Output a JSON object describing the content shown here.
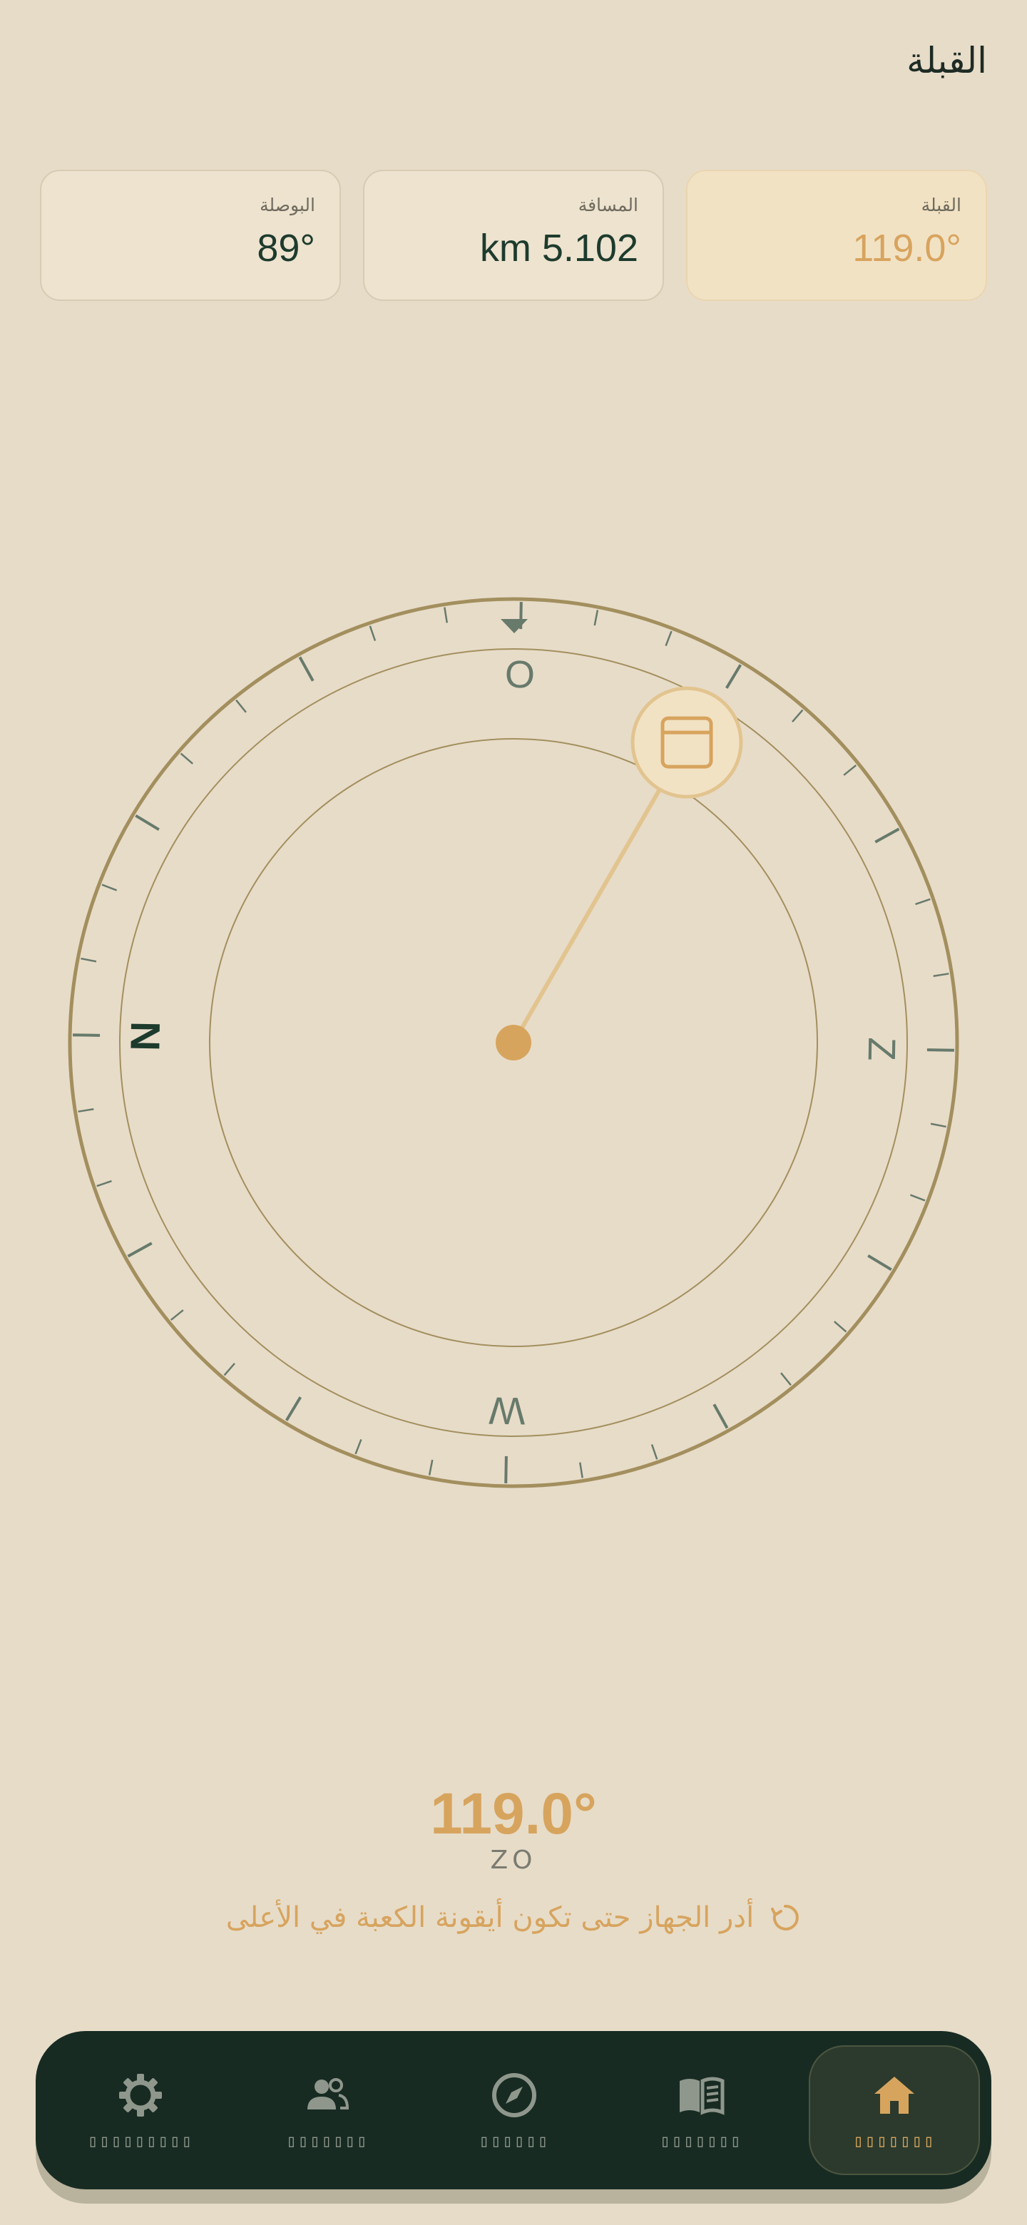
{
  "header": {
    "title": "القبلة"
  },
  "stats": [
    {
      "label": "القبلة",
      "value": "119.0°"
    },
    {
      "label": "المسافة",
      "value": "km 5.102"
    },
    {
      "label": "البوصلة",
      "value": "89°"
    }
  ],
  "compass": {
    "qibla_bearing": 119.0,
    "device_heading": 89,
    "cardinal_labels": {
      "north": "N",
      "east": "O",
      "south": "Z",
      "west": "W"
    }
  },
  "readout": {
    "degrees": "119.0°",
    "direction": "ZO",
    "hint": "أدر الجهاز حتى تكون أيقونة الكعبة في الأعلى"
  },
  "bottom_nav": {
    "items": [
      {
        "icon": "home-icon",
        "label": "▯▯▯▯▯▯▯",
        "active": true
      },
      {
        "icon": "book-icon",
        "label": "▯▯▯▯▯▯▯",
        "active": false
      },
      {
        "icon": "compass-icon",
        "label": "▯▯▯▯▯▯",
        "active": false
      },
      {
        "icon": "people-icon",
        "label": "▯▯▯▯▯▯▯",
        "active": false
      },
      {
        "icon": "gear-icon",
        "label": "▯▯▯▯▯▯▯▯▯",
        "active": false
      }
    ]
  },
  "colors": {
    "background": "#e7dcc8",
    "accent": "#d7a45e",
    "dark": "#172b23",
    "ring": "#a38f5e"
  }
}
